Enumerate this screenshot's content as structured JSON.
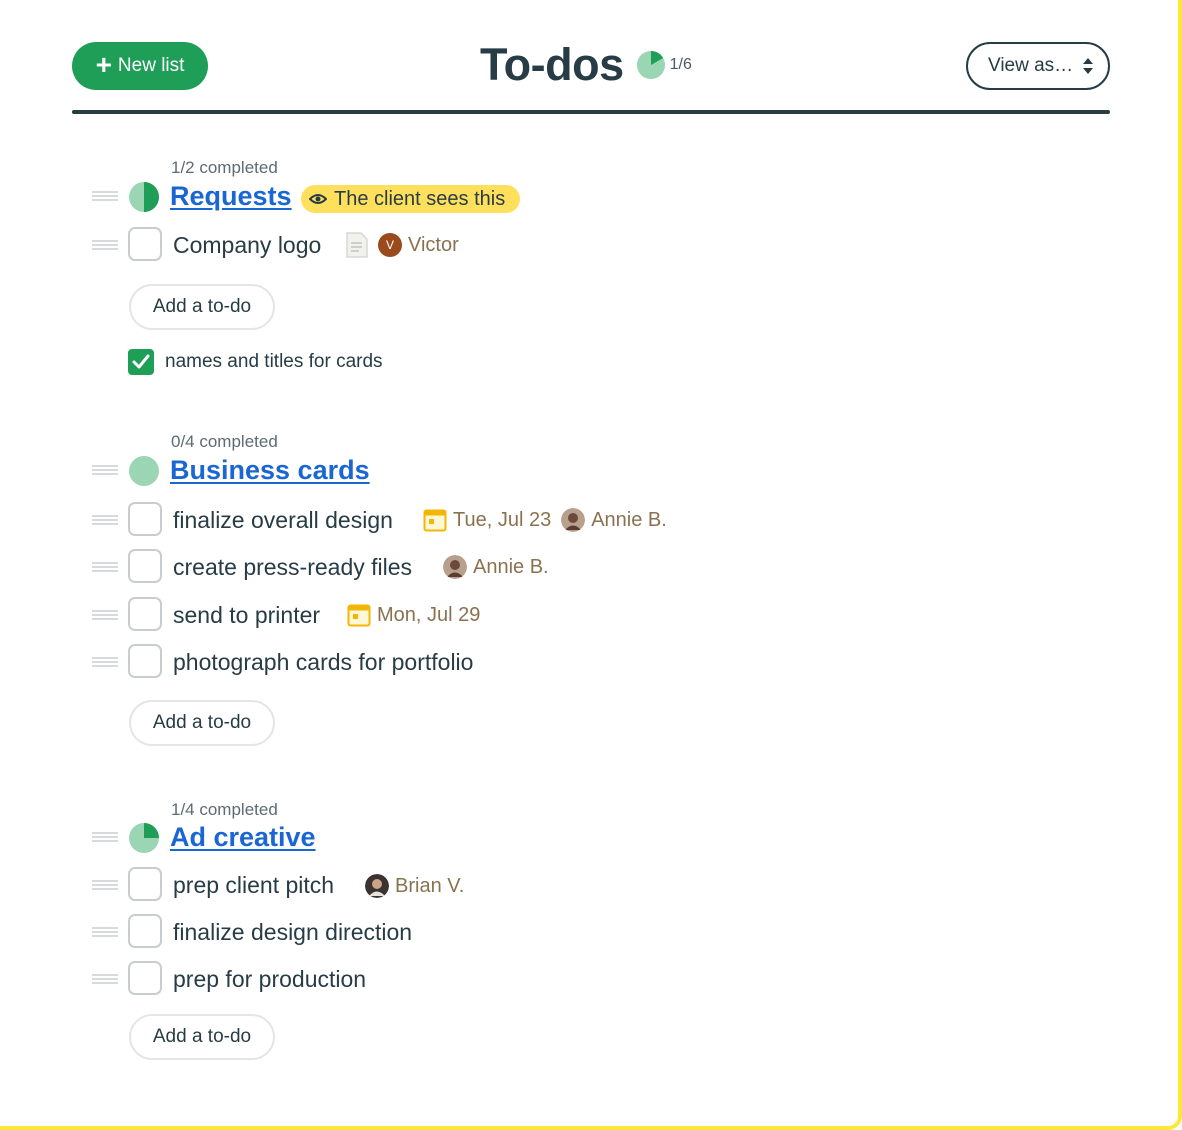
{
  "header": {
    "new_list_label": "New list",
    "title": "To-dos",
    "progress": "1/6",
    "progress_fraction": 0.1667,
    "view_as_label": "View as…"
  },
  "lists": [
    {
      "completed": "1/2 completed",
      "progress_fraction": 0.5,
      "title": "Requests",
      "badge": "The client sees this",
      "todos": [
        {
          "text": "Company logo",
          "assignee": "Victor",
          "assignee_initial": "V"
        }
      ],
      "add_label": "Add a to-do",
      "done": [
        {
          "text": "names and titles for cards"
        }
      ]
    },
    {
      "completed": "0/4 completed",
      "progress_fraction": 0,
      "title": "Business cards",
      "todos": [
        {
          "text": "finalize overall design",
          "due": "Tue, Jul 23",
          "assignee": "Annie B."
        },
        {
          "text": "create press-ready files",
          "assignee": "Annie B."
        },
        {
          "text": "send to printer",
          "due": "Mon, Jul 29"
        },
        {
          "text": "photograph cards for portfolio"
        }
      ],
      "add_label": "Add a to-do"
    },
    {
      "completed": "1/4 completed",
      "progress_fraction": 0.25,
      "title": "Ad creative",
      "todos": [
        {
          "text": "prep client pitch",
          "assignee": "Brian V."
        },
        {
          "text": "finalize design direction"
        },
        {
          "text": "prep for production"
        }
      ],
      "add_label": "Add a to-do"
    }
  ],
  "colors": {
    "accent_green": "#1e9e56",
    "pie_fill": "#1e9e56",
    "pie_track": "#9ad6b3",
    "link_blue": "#1a66d2",
    "badge_yellow": "#ffe05c",
    "meta_brown": "#8a7250",
    "frame_yellow": "#ffe733"
  },
  "icons": [
    "plus-icon",
    "pie-progress-icon",
    "updown-arrows-icon",
    "drag-handle-icon",
    "eye-icon",
    "note-icon",
    "calendar-icon",
    "avatar",
    "checkmark-icon"
  ]
}
